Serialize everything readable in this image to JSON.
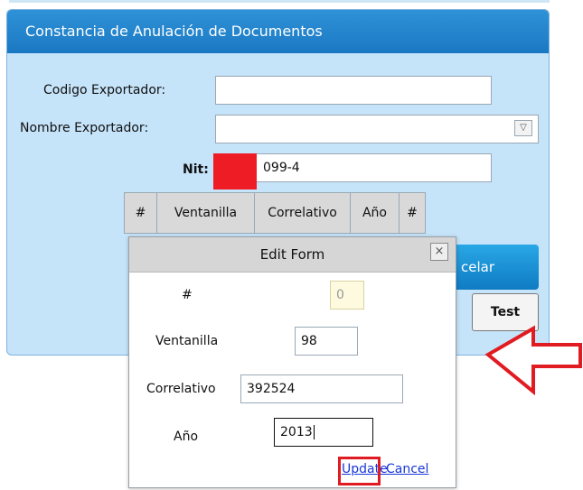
{
  "panel": {
    "title": "Constancia de Anulación de Documentos",
    "fields": {
      "codigo_label": "Codigo Exportador:",
      "codigo_value": "",
      "nombre_label": "Nombre Exportador:",
      "nombre_value": "",
      "nit_label": "Nit:",
      "nit_value": "099-4"
    },
    "grid_headers": [
      "#",
      "Ventanilla",
      "Correlativo",
      "Año",
      "#"
    ],
    "cancel_fragment": "celar",
    "test_label": "Test"
  },
  "edit_form": {
    "title": "Edit Form",
    "close_symbol": "×",
    "fields": [
      {
        "label": "#",
        "value": "0"
      },
      {
        "label": "Ventanilla",
        "value": "98"
      },
      {
        "label": "Correlativo",
        "value": "392524"
      },
      {
        "label": "Año",
        "value": "2013"
      }
    ],
    "update_label": "Update",
    "cancel_label": "Cancel"
  },
  "colors": {
    "header_blue": "#1f85cc",
    "panel_bg": "#c5e3f9",
    "highlight_red": "#e11b22"
  }
}
